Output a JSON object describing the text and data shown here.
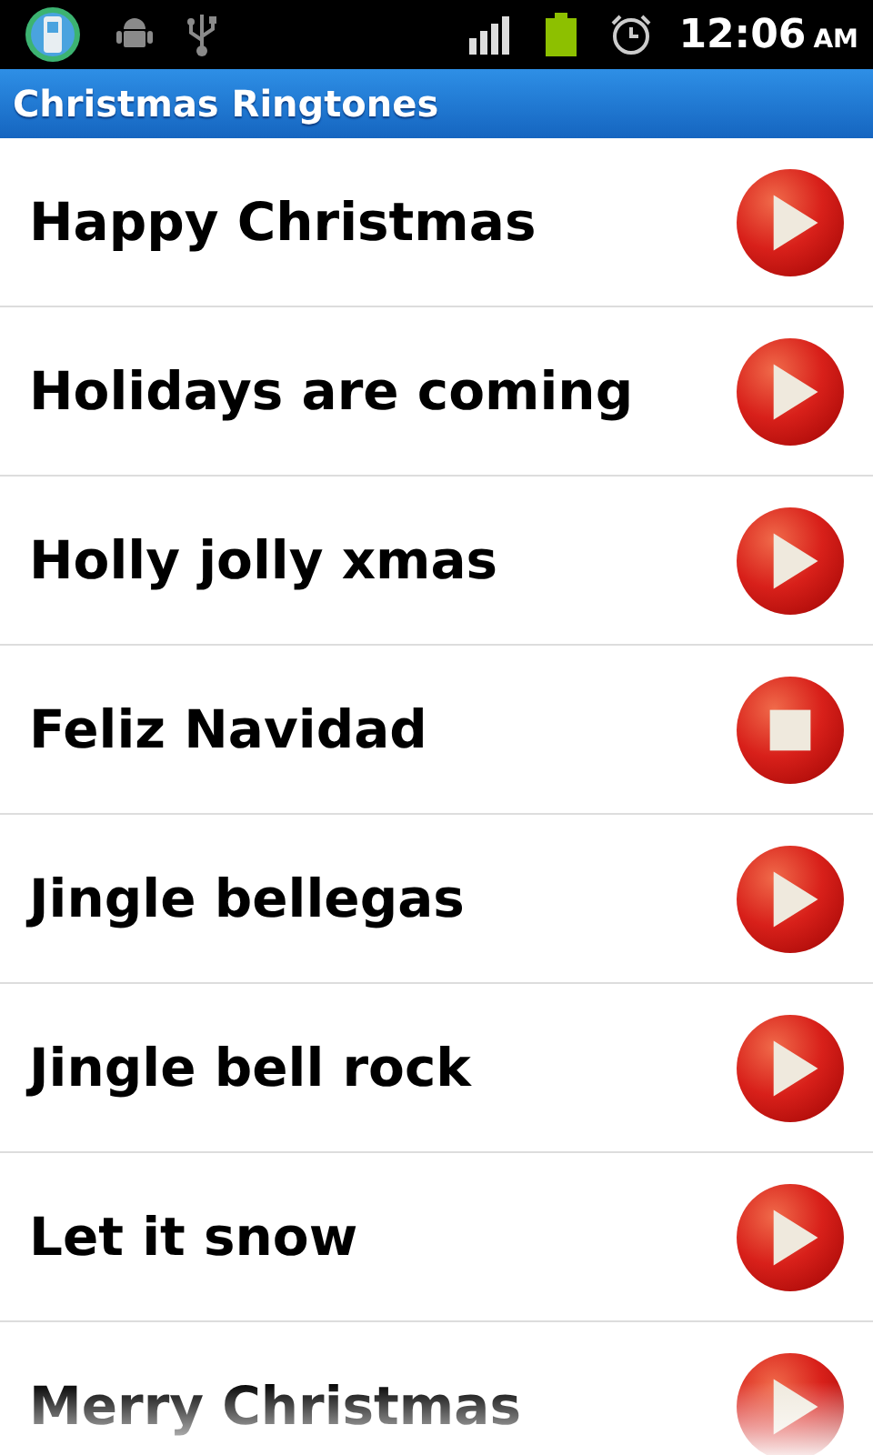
{
  "status_bar": {
    "time": "12:06",
    "period": "AM"
  },
  "title": "Christmas Ringtones",
  "ringtones": [
    {
      "name": "Happy Christmas",
      "playing": false
    },
    {
      "name": "Holidays are coming",
      "playing": false
    },
    {
      "name": "Holly jolly xmas",
      "playing": false
    },
    {
      "name": "Feliz Navidad",
      "playing": true
    },
    {
      "name": "Jingle bellegas",
      "playing": false
    },
    {
      "name": "Jingle bell rock",
      "playing": false
    },
    {
      "name": "Let it snow",
      "playing": false
    },
    {
      "name": "Merry Christmas",
      "playing": false
    }
  ]
}
